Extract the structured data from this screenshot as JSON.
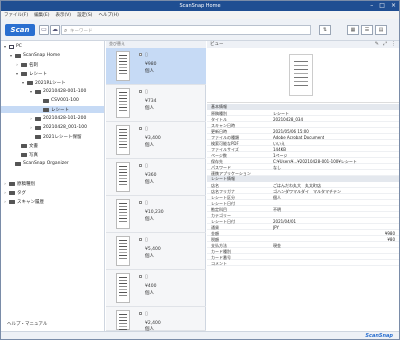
{
  "window": {
    "title": "ScanSnap Home"
  },
  "menu": [
    "ファイル(F)",
    "編集(E)",
    "表示(V)",
    "設定(S)",
    "ヘルプ(H)"
  ],
  "toolbar": {
    "scan_label": "Scan",
    "search_placeholder": "キーワード"
  },
  "tree": [
    {
      "label": "PC"
    },
    {
      "label": "ScanSnap Home"
    },
    {
      "label": "名刺"
    },
    {
      "label": "レシート"
    },
    {
      "label": "2021RLシート"
    },
    {
      "label": "20210428-001-100"
    },
    {
      "label": "CSV001-100"
    },
    {
      "label": "レシート"
    },
    {
      "label": "20210428-101-200"
    },
    {
      "label": "20210428_001-100"
    },
    {
      "label": "2021レシート保留"
    },
    {
      "label": "文書"
    },
    {
      "label": "写真"
    },
    {
      "label": "ScanSnap Organizer"
    },
    {
      "label": "原稿種別"
    },
    {
      "label": "タグ"
    },
    {
      "label": "スキャン履歴"
    }
  ],
  "help_link": "ヘルプ・マニュアル",
  "list": {
    "header": "並び替え",
    "items": [
      {
        "amount": "¥980",
        "who": "個人"
      },
      {
        "amount": "¥734",
        "who": "個人"
      },
      {
        "amount": "¥3,400",
        "who": "個人"
      },
      {
        "amount": "¥360",
        "who": "個人"
      },
      {
        "amount": "¥10,230",
        "who": "個人"
      },
      {
        "amount": "¥5,400",
        "who": "個人"
      },
      {
        "amount": "¥400",
        "who": "個人"
      },
      {
        "amount": "¥2,400",
        "who": "個人"
      }
    ]
  },
  "detail": {
    "preview_label": "ビュー",
    "basic_section": "基本情報",
    "basic": [
      {
        "k": "原稿種別",
        "v": "レシート"
      },
      {
        "k": "タイトル",
        "v": "20210428_034"
      },
      {
        "k": "スキャン日時",
        "v": ""
      },
      {
        "k": "更新日時",
        "v": "2021/05/06 15:00"
      },
      {
        "k": "ファイルの種類",
        "v": "Adobe Acrobat Document"
      },
      {
        "k": "検索可能なPDF",
        "v": "いいえ"
      },
      {
        "k": "ファイルサイズ",
        "v": "144KB"
      },
      {
        "k": "ページ数",
        "v": "1ページ"
      },
      {
        "k": "保存先",
        "v": "C:¥Users¥...¥20210428-001-100¥レシート"
      },
      {
        "k": "パスワード",
        "v": "なし"
      },
      {
        "k": "連携アプリケーション",
        "v": ""
      }
    ],
    "receipt_section": "レシート情報",
    "receipt": [
      {
        "k": "店名",
        "v": "ごはんだわ丸大　丸太町店"
      },
      {
        "k": "店名フリガナ",
        "v": "ゴハンダワマルダイ　マルタマチテン"
      },
      {
        "k": "レシート区分",
        "v": "個人"
      },
      {
        "k": "レシート日付",
        "v": ""
      },
      {
        "k": "勘定科目",
        "v": "不明"
      },
      {
        "k": "カテゴリー",
        "v": ""
      },
      {
        "k": "レシート日付",
        "v": "2021/04/01"
      },
      {
        "k": "通貨",
        "v": "JPY"
      },
      {
        "k": "金額",
        "v": "¥980"
      },
      {
        "k": "税額",
        "v": "¥80"
      },
      {
        "k": "支払方法",
        "v": "現金"
      },
      {
        "k": "カード種別",
        "v": ""
      },
      {
        "k": "カード番号",
        "v": ""
      },
      {
        "k": "コメント",
        "v": ""
      }
    ]
  },
  "status": {
    "logo": "ScanSnap"
  }
}
